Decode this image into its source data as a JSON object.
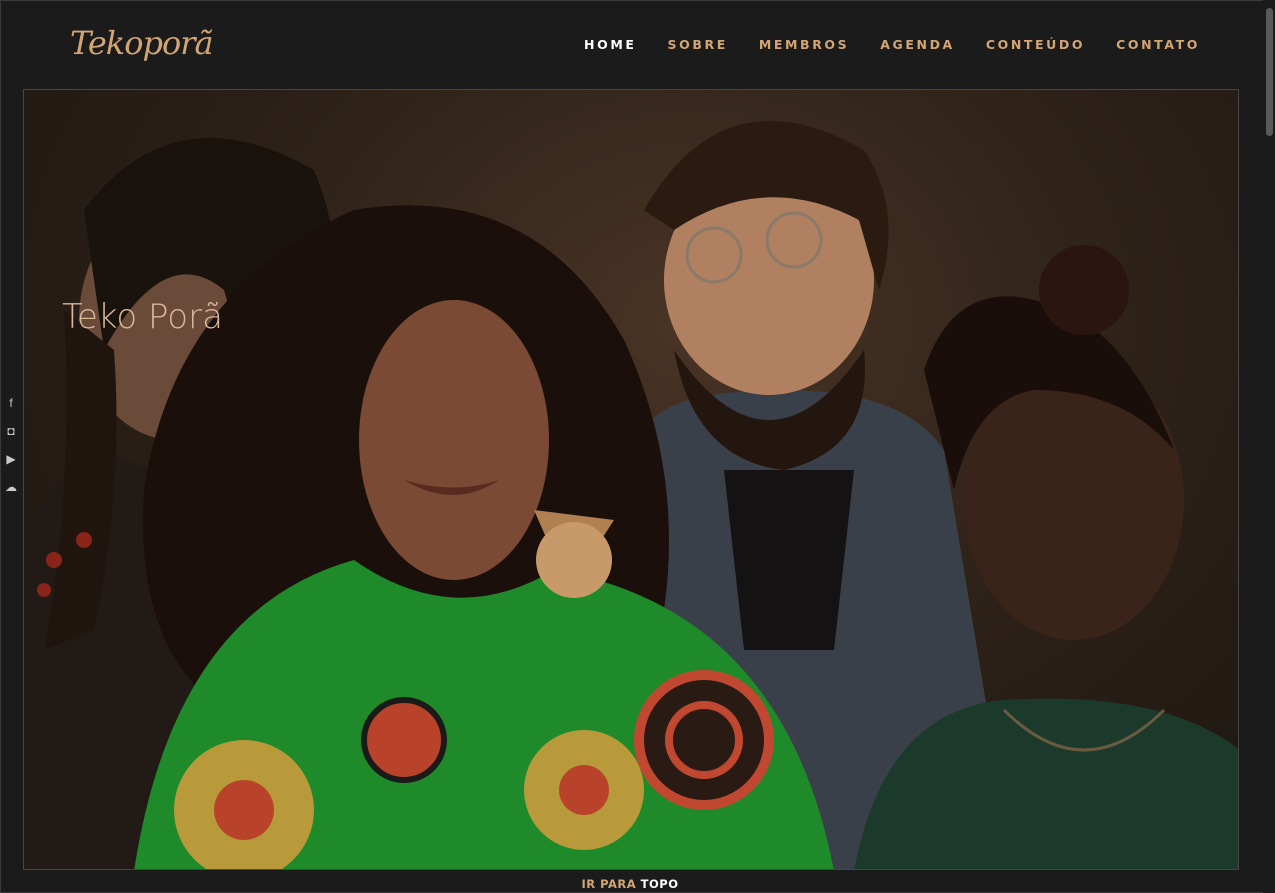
{
  "header": {
    "logo": "Tekoporã",
    "nav": [
      {
        "label": "HOME",
        "active": true
      },
      {
        "label": "SOBRE",
        "active": false
      },
      {
        "label": "MEMBROS",
        "active": false
      },
      {
        "label": "AGENDA",
        "active": false
      },
      {
        "label": "CONTEÚDO",
        "active": false
      },
      {
        "label": "CONTATO",
        "active": false
      }
    ]
  },
  "hero": {
    "title": "Teko Porã"
  },
  "social": {
    "icons": [
      "facebook-icon",
      "instagram-icon",
      "youtube-icon",
      "soundcloud-icon"
    ],
    "glyphs": [
      "f",
      "◘",
      "▶",
      "☁"
    ]
  },
  "footer": {
    "part1": "IR PARA",
    "part2": "TOPO"
  },
  "colors": {
    "accent": "#d4a574",
    "background": "#1c1b1b",
    "active_nav": "#ffffff"
  }
}
